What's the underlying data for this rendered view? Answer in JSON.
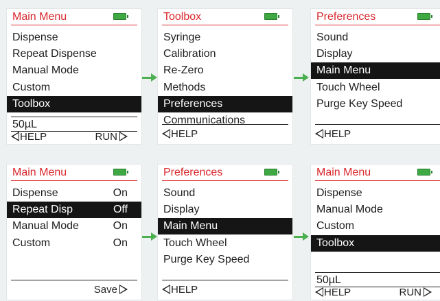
{
  "screens": [
    {
      "title": "Main Menu",
      "items": [
        {
          "label": "Dispense"
        },
        {
          "label": "Repeat Dispense"
        },
        {
          "label": "Manual Mode"
        },
        {
          "label": "Custom"
        },
        {
          "label": "Toolbox",
          "selected": true
        }
      ],
      "volume": "50µL",
      "footer": {
        "left": "HELP",
        "right": "RUN"
      }
    },
    {
      "title": "Toolbox",
      "items": [
        {
          "label": "Syringe"
        },
        {
          "label": "Calibration"
        },
        {
          "label": "Re-Zero"
        },
        {
          "label": "Methods"
        },
        {
          "label": "Preferences",
          "selected": true
        },
        {
          "label": "Communications"
        }
      ],
      "footer": {
        "left": "HELP"
      }
    },
    {
      "title": "Preferences",
      "items": [
        {
          "label": "Sound"
        },
        {
          "label": "Display"
        },
        {
          "label": "Main Menu",
          "selected": true
        },
        {
          "label": "Touch Wheel"
        },
        {
          "label": "Purge Key Speed"
        }
      ],
      "footer": {
        "left": "HELP"
      }
    },
    {
      "title": "Main Menu",
      "items": [
        {
          "label": "Dispense",
          "value": "On"
        },
        {
          "label": "Repeat Disp",
          "value": "Off",
          "selected": true
        },
        {
          "label": "Manual Mode",
          "value": "On"
        },
        {
          "label": "Custom",
          "value": "On"
        }
      ],
      "footer": {
        "right": "Save"
      }
    },
    {
      "title": "Preferences",
      "items": [
        {
          "label": "Sound"
        },
        {
          "label": "Display"
        },
        {
          "label": "Main Menu",
          "selected": true
        },
        {
          "label": "Touch Wheel"
        },
        {
          "label": "Purge Key Speed"
        }
      ],
      "footer": {
        "left": "HELP"
      }
    },
    {
      "title": "Main Menu",
      "items": [
        {
          "label": "Dispense"
        },
        {
          "label": "Manual Mode"
        },
        {
          "label": "Custom"
        },
        {
          "label": "Toolbox",
          "selected": true
        }
      ],
      "volume": "50µL",
      "footer": {
        "left": "HELP",
        "right": "RUN"
      }
    }
  ],
  "colors": {
    "title": "#d9262b",
    "battery": "#3ea842",
    "arrow": "#4caf50",
    "selection": "#151515"
  },
  "icons": {
    "battery": "battery-icon",
    "help_arrow": "triangle-left-icon",
    "action_arrow": "triangle-right-icon",
    "flow_arrow": "green-arrow-icon"
  }
}
